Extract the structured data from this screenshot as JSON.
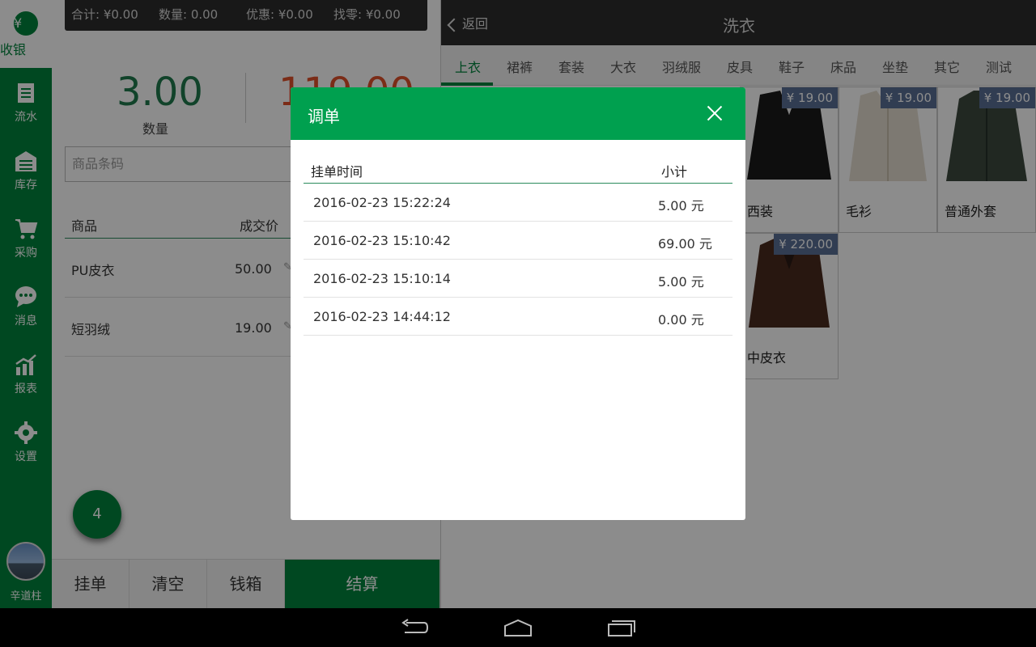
{
  "sidebar": {
    "cashier_label": "收银",
    "cashier_symbol": "¥",
    "items": [
      {
        "label": "流水",
        "icon": "receipt-icon"
      },
      {
        "label": "库存",
        "icon": "warehouse-icon"
      },
      {
        "label": "采购",
        "icon": "cart-icon"
      },
      {
        "label": "消息",
        "icon": "chat-icon"
      },
      {
        "label": "报表",
        "icon": "chart-icon"
      },
      {
        "label": "设置",
        "icon": "gear-icon"
      }
    ],
    "user_name": "辛道柱"
  },
  "summary": {
    "total": "合计: ¥0.00",
    "quantity": "数量: 0.00",
    "discount": "优惠: ¥0.00",
    "change": "找零: ¥0.00"
  },
  "totals": {
    "quantity_value": "3.00",
    "quantity_label": "数量",
    "amount_value": "119.00"
  },
  "barcode": {
    "placeholder": "商品条码"
  },
  "cart": {
    "headers": {
      "product": "商品",
      "price": "成交价"
    },
    "rows": [
      {
        "name": "PU皮衣",
        "price": "50.00"
      },
      {
        "name": "短羽绒",
        "price": "19.00"
      }
    ]
  },
  "fab_count": "4",
  "bottom_buttons": {
    "hold": "挂单",
    "clear": "清空",
    "drawer": "钱箱",
    "checkout": "结算"
  },
  "right": {
    "back_label": "返回",
    "title": "洗衣",
    "tabs": [
      "上衣",
      "裙裤",
      "套装",
      "大衣",
      "羽绒服",
      "皮具",
      "鞋子",
      "床品",
      "坐垫",
      "其它",
      "测试"
    ],
    "products": [
      {
        "name": "西装",
        "price": "¥ 19.00"
      },
      {
        "name": "毛衫",
        "price": "¥ 19.00"
      },
      {
        "name": "普通外套",
        "price": "¥ 19.00"
      },
      {
        "name": "中皮衣",
        "price": "¥ 220.00"
      }
    ]
  },
  "dialog": {
    "title": "调单",
    "headers": {
      "time": "挂单时间",
      "subtotal": "小计"
    },
    "rows": [
      {
        "time": "2016-02-23 15:22:24",
        "subtotal": "5.00 元"
      },
      {
        "time": "2016-02-23 15:10:42",
        "subtotal": "69.00 元"
      },
      {
        "time": "2016-02-23 15:10:14",
        "subtotal": "5.00 元"
      },
      {
        "time": "2016-02-23 14:44:12",
        "subtotal": "0.00 元"
      }
    ]
  },
  "colors": {
    "brand_green": "#00843d",
    "dialog_green": "#00a04f",
    "price_tag": "#5a6f96"
  }
}
